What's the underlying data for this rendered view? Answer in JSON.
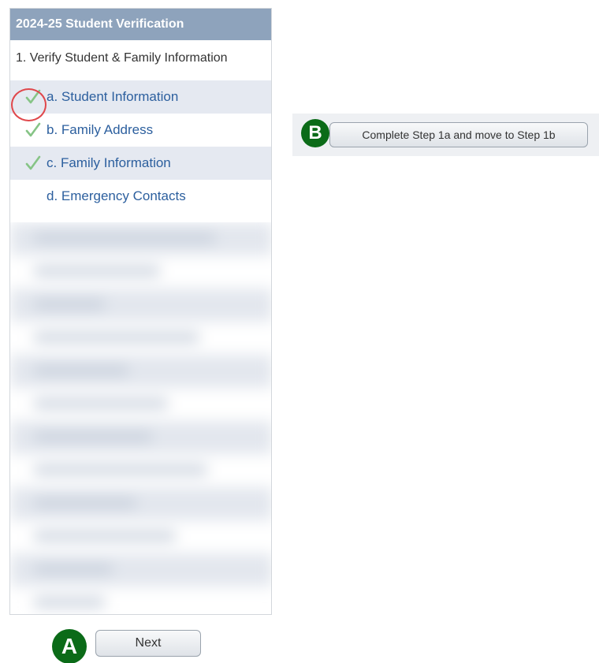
{
  "panel": {
    "title": "2024-25 Student Verification",
    "step_title": "1. Verify Student & Family Information",
    "items": [
      {
        "label": "a. Student Information",
        "checked": true
      },
      {
        "label": "b. Family Address",
        "checked": true
      },
      {
        "label": "c. Family Information",
        "checked": true
      },
      {
        "label": "d. Emergency Contacts",
        "checked": false
      }
    ]
  },
  "annotations": {
    "badge_a": "A",
    "badge_b": "B"
  },
  "buttons": {
    "next_label": "Next",
    "step_label": "Complete Step 1a and move to Step 1b"
  },
  "colors": {
    "header_bg": "#8ea3bc",
    "link": "#2c5f9e",
    "badge": "#0b6b18",
    "highlight": "#e0474b",
    "check": "#7cc07c"
  }
}
